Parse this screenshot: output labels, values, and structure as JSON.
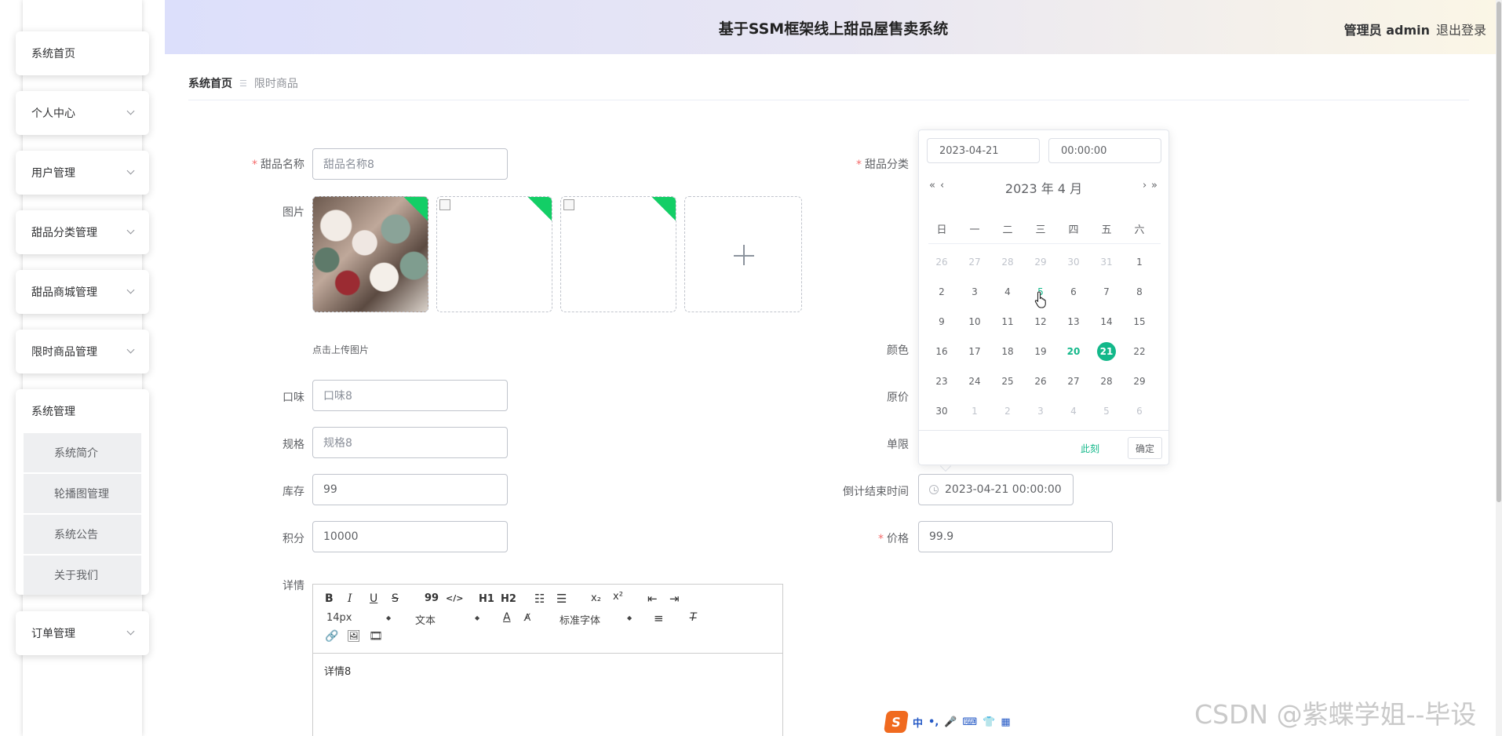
{
  "header": {
    "title": "基于SSM框架线上甜品屋售卖系统",
    "user": "管理员 admin",
    "logout": "退出登录"
  },
  "sidebar": {
    "home": "系统首页",
    "personal": "个人中心",
    "users": "用户管理",
    "category": "甜品分类管理",
    "mall": "甜品商城管理",
    "limited": "限时商品管理",
    "system": "系统管理",
    "system_items": [
      "系统简介",
      "轮播图管理",
      "系统公告",
      "关于我们"
    ],
    "orders": "订单管理"
  },
  "breadcrumb": {
    "home": "系统首页",
    "sep": "☰",
    "current": "限时商品"
  },
  "form": {
    "name_label": "甜品名称",
    "name_placeholder": "甜品名称8",
    "image_label": "图片",
    "upload_hint": "点击上传图片",
    "taste_label": "口味",
    "taste_placeholder": "口味8",
    "spec_label": "规格",
    "spec_placeholder": "规格8",
    "stock_label": "库存",
    "stock_value": "99",
    "points_label": "积分",
    "points_value": "10000",
    "detail_label": "详情",
    "category_label": "甜品分类",
    "color_label": "颜色",
    "orig_price_label": "原价",
    "limit_label": "单限",
    "end_time_label": "倒计结束时间",
    "end_time_value": "2023-04-21 00:00:00",
    "price_label": "价格",
    "price_value": "99.9"
  },
  "editor": {
    "font_size": "14px",
    "text_type": "文本",
    "font_family": "标准字体",
    "content": "详情8",
    "buttons": [
      "B",
      "I",
      "U",
      "S",
      "99",
      "</>",
      "H1",
      "H2",
      "x₂",
      "x²"
    ]
  },
  "datepicker": {
    "date_input": "2023-04-21",
    "time_input": "00:00:00",
    "year_month": "2023 年  4 月",
    "weekdays": [
      "日",
      "一",
      "二",
      "三",
      "四",
      "五",
      "六"
    ],
    "weeks": [
      [
        "26",
        "27",
        "28",
        "29",
        "30",
        "31",
        "1"
      ],
      [
        "2",
        "3",
        "4",
        "5",
        "6",
        "7",
        "8"
      ],
      [
        "9",
        "10",
        "11",
        "12",
        "13",
        "14",
        "15"
      ],
      [
        "16",
        "17",
        "18",
        "19",
        "20",
        "21",
        "22"
      ],
      [
        "23",
        "24",
        "25",
        "26",
        "27",
        "28",
        "29"
      ],
      [
        "30",
        "1",
        "2",
        "3",
        "4",
        "5",
        "6"
      ]
    ],
    "today": "20",
    "selected": "21",
    "hovered": "5",
    "now_label": "此刻",
    "ok_label": "确定"
  },
  "ime": {
    "lang": "中",
    "dot": "•,",
    "mic": "🎤",
    "kbd": "⌨",
    "shirt": "👕",
    "grid": "▦"
  },
  "watermark": "CSDN @紫蝶学姐--毕设",
  "colors": {
    "accent": "#13b88a",
    "required": "#f56c6c",
    "upload_corner": "#13ce66"
  }
}
